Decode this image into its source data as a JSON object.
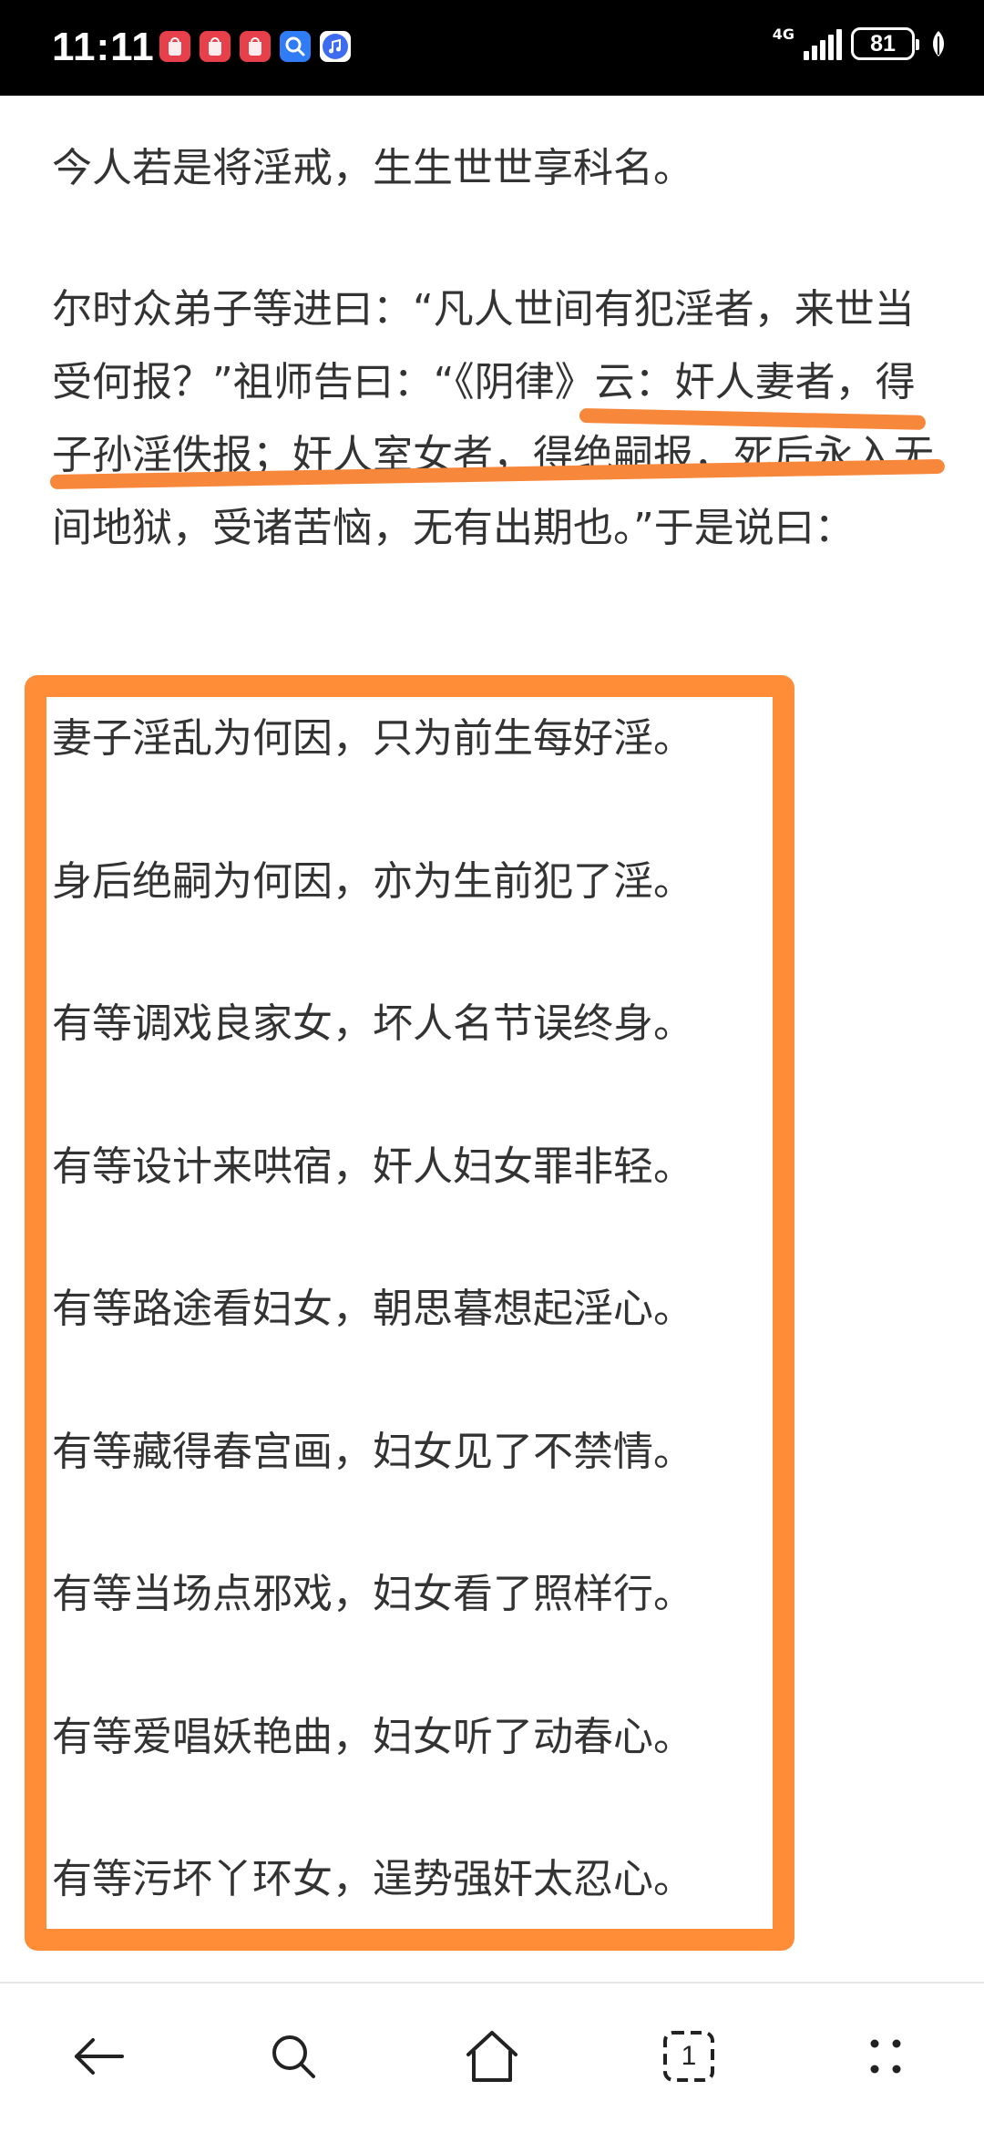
{
  "status_bar": {
    "time": "11:11",
    "network": "4G",
    "battery": "81",
    "notification_icons": [
      "huawei-icon",
      "huawei-icon",
      "huawei-icon",
      "search-icon",
      "music-icon"
    ]
  },
  "article": {
    "paragraph1": "今人若是将淫戒，生生世世享科名。",
    "paragraph2": "尔时众弟子等进曰：“凡人世间有犯淫者，来世当受何报？”祖师告曰：“《阴律》云：奸人妻者，得子孙淫佚报；奸人室女者，得绝嗣报，死后永入无间地狱，受诸苦恼，无有出期也。”于是说曰：",
    "verses": [
      "妻子淫乱为何因，只为前生每好淫。",
      "身后绝嗣为何因，亦为生前犯了淫。",
      "有等调戏良家女，坏人名节误终身。",
      "有等设计来哄宿，奸人妇女罪非轻。",
      "有等路途看妇女，朝思暮想起淫心。",
      "有等藏得春宫画，妇女见了不禁情。",
      "有等当场点邪戏，妇女看了照样行。",
      "有等爱唱妖艳曲，妇女听了动春心。",
      "有等污坏丫环女，逞势强奸太忍心。"
    ]
  },
  "annotation": {
    "color": "#ff8d38"
  },
  "bottom_nav": {
    "tab_count": "1",
    "icons": [
      "back-arrow-icon",
      "search-icon",
      "home-icon",
      "tabs-icon",
      "menu-icon"
    ]
  }
}
